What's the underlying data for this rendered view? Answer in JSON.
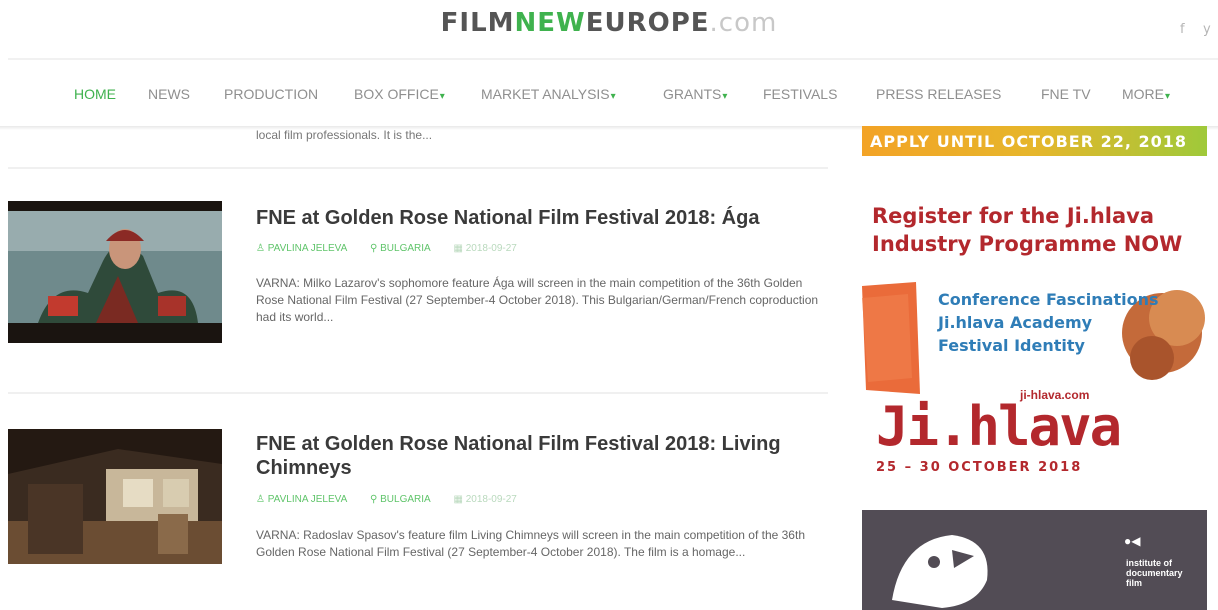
{
  "header": {
    "logo_part1": "FILM",
    "logo_part2": "NEW",
    "logo_part3": "EUROPE",
    "logo_part4": ".com",
    "social_fb": "f",
    "social_tw": "y"
  },
  "nav": {
    "home": "HOME",
    "news": "NEWS",
    "production": "PRODUCTION",
    "box_office": "BOX OFFICE",
    "market_analysis": "MARKET ANALYSIS",
    "grants": "GRANTS",
    "festivals": "FESTIVALS",
    "press_releases": "PRESS RELEASES",
    "fne_tv": "FNE TV",
    "more": "MORE",
    "caret": "▾"
  },
  "articles": {
    "stub_excerpt": "local film professionals. It is the...",
    "a1": {
      "title": "FNE at Golden Rose National Film Festival 2018: Ága",
      "author": "PAVLINA JELEVA",
      "country": "BULGARIA",
      "date": "2018-09-27",
      "excerpt": "VARNA: Milko Lazarov's sophomore feature Ága will screen in the main competition of the 36th Golden Rose National Film Festival (27 September-4 October 2018). This Bulgarian/German/French coproduction had its world..."
    },
    "a2": {
      "title": "FNE at Golden Rose National Film Festival 2018: Living Chimneys",
      "author": "PAVLINA JELEVA",
      "country": "BULGARIA",
      "date": "2018-09-27",
      "excerpt": "VARNA: Radoslav Spasov's feature film Living Chimneys will screen in the main competition of the 36th Golden Rose National Film Festival (27 September-4 October 2018). The film is a homage..."
    }
  },
  "sidebar": {
    "banner_apply": "APPLY UNTIL OCTOBER 22, 2018",
    "jihlava_line1": "Register for the Ji.hlava",
    "jihlava_line2": "Industry Programme NOW",
    "jihlava_item1": "Conference Fascinations",
    "jihlava_item2": "Ji.hlava Academy",
    "jihlava_item3": "Festival Identity",
    "jihlava_url": "ji-hlava.com",
    "jihlava_big": "Ji.hlava",
    "jihlava_dates": "25 – 30 OCTOBER 2018",
    "idf_line1": "institute of",
    "idf_line2": "documentary",
    "idf_line3": "film"
  }
}
